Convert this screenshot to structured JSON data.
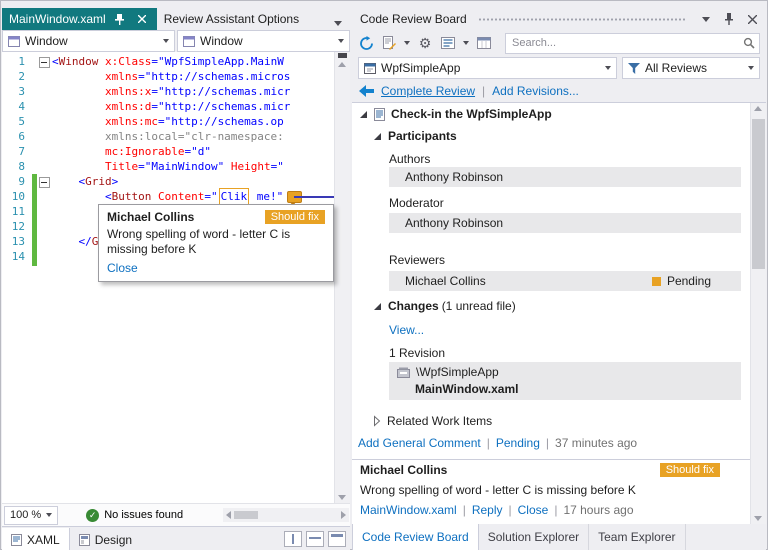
{
  "ui": {
    "sep": "|"
  },
  "icons": {
    "gear": "⚙",
    "check": "✓"
  },
  "editor": {
    "tabs": [
      {
        "label": "MainWindow.xaml"
      },
      {
        "label": "Review Assistant Options"
      }
    ],
    "nav_dropdowns": [
      {
        "label": "Window"
      },
      {
        "label": "Window"
      }
    ],
    "code_lines": [
      {
        "n": "1",
        "fold": true,
        "segs": [
          [
            "p",
            "<"
          ],
          [
            "e",
            "Window"
          ],
          [
            "t",
            " "
          ],
          [
            "a",
            "x:Class"
          ],
          [
            "p",
            "="
          ],
          [
            "v",
            "\"WpfSimpleApp.MainW"
          ]
        ]
      },
      {
        "n": "2",
        "segs": [
          [
            "t",
            "        "
          ],
          [
            "a",
            "xmlns"
          ],
          [
            "p",
            "="
          ],
          [
            "v",
            "\"http://schemas.micros"
          ]
        ]
      },
      {
        "n": "3",
        "segs": [
          [
            "t",
            "        "
          ],
          [
            "a",
            "xmlns:x"
          ],
          [
            "p",
            "="
          ],
          [
            "v",
            "\"http://schemas.micr"
          ]
        ]
      },
      {
        "n": "4",
        "segs": [
          [
            "t",
            "        "
          ],
          [
            "a",
            "xmlns:d"
          ],
          [
            "p",
            "="
          ],
          [
            "v",
            "\"http://schemas.micr"
          ]
        ]
      },
      {
        "n": "5",
        "segs": [
          [
            "t",
            "        "
          ],
          [
            "a",
            "xmlns:mc"
          ],
          [
            "p",
            "="
          ],
          [
            "v",
            "\"http://schemas.op"
          ]
        ]
      },
      {
        "n": "6",
        "segs": [
          [
            "g",
            "        xmlns:local=\"clr-namespace:"
          ]
        ]
      },
      {
        "n": "7",
        "segs": [
          [
            "t",
            "        "
          ],
          [
            "a",
            "mc:Ignorable"
          ],
          [
            "p",
            "="
          ],
          [
            "v",
            "\"d\""
          ]
        ]
      },
      {
        "n": "8",
        "segs": [
          [
            "t",
            "        "
          ],
          [
            "a",
            "Title"
          ],
          [
            "p",
            "="
          ],
          [
            "v",
            "\"MainWindow\""
          ],
          [
            "t",
            " "
          ],
          [
            "a",
            "Height"
          ],
          [
            "p",
            "="
          ],
          [
            "v",
            "\""
          ]
        ]
      },
      {
        "n": "9",
        "fold": true,
        "segs": [
          [
            "t",
            "    "
          ],
          [
            "p",
            "<"
          ],
          [
            "e",
            "Grid"
          ],
          [
            "p",
            ">"
          ]
        ]
      },
      {
        "n": "10",
        "segs": [
          [
            "t",
            "        "
          ],
          [
            "p",
            "<"
          ],
          [
            "e",
            "Button"
          ],
          [
            "t",
            " "
          ],
          [
            "a",
            "Content"
          ],
          [
            "p",
            "="
          ],
          [
            "v",
            "\""
          ],
          [
            "box",
            "Clik"
          ],
          [
            "v",
            " me!\""
          ],
          [
            "bubble",
            ""
          ]
        ]
      },
      {
        "n": "11",
        "segs": []
      },
      {
        "n": "12",
        "segs": []
      },
      {
        "n": "13",
        "segs": [
          [
            "t",
            "    "
          ],
          [
            "p",
            "</"
          ],
          [
            "e",
            "Grid"
          ],
          [
            "p",
            ">"
          ]
        ]
      },
      {
        "n": "14",
        "segs": []
      }
    ],
    "zoom": "100 %",
    "status_text": "No issues found",
    "bottom_tabs": [
      {
        "label": "XAML"
      },
      {
        "label": "Design"
      }
    ]
  },
  "tooltip": {
    "author": "Michael Collins",
    "badge": "Should fix",
    "text": "Wrong spelling of word - letter C is missing before K",
    "close_label": "Close"
  },
  "panel": {
    "title": "Code Review Board",
    "search_placeholder": "Search...",
    "project": "WpfSimpleApp",
    "filter": "All Reviews",
    "back_links": {
      "complete": "Complete Review",
      "add_revisions": "Add Revisions..."
    },
    "tree": {
      "check_in": "Check-in the WpfSimpleApp",
      "participants": "Participants",
      "authors_label": "Authors",
      "author_name": "Anthony Robinson",
      "moderator_label": "Moderator",
      "moderator_name": "Anthony Robinson",
      "reviewers_label": "Reviewers",
      "reviewer_name": "Michael Collins",
      "reviewer_status": "Pending",
      "changes_bold": "Changes",
      "changes_rest": " (1 unread file)",
      "view_link": "View...",
      "revision_label": "1 Revision",
      "changeset_path": "\\WpfSimpleApp",
      "changeset_file": "MainWindow.xaml",
      "related_work_items": "Related Work Items"
    },
    "footer": {
      "add_general": "Add General Comment",
      "pending": "Pending",
      "ago": "37 minutes ago"
    },
    "comment": {
      "author": "Michael Collins",
      "badge": "Should fix",
      "text": "Wrong spelling of word - letter C is missing before K",
      "file_link": "MainWindow.xaml",
      "reply": "Reply",
      "close": "Close",
      "ago": "17 hours ago"
    },
    "tabs": [
      {
        "label": "Code Review Board"
      },
      {
        "label": "Solution Explorer"
      },
      {
        "label": "Team Explorer"
      }
    ]
  }
}
